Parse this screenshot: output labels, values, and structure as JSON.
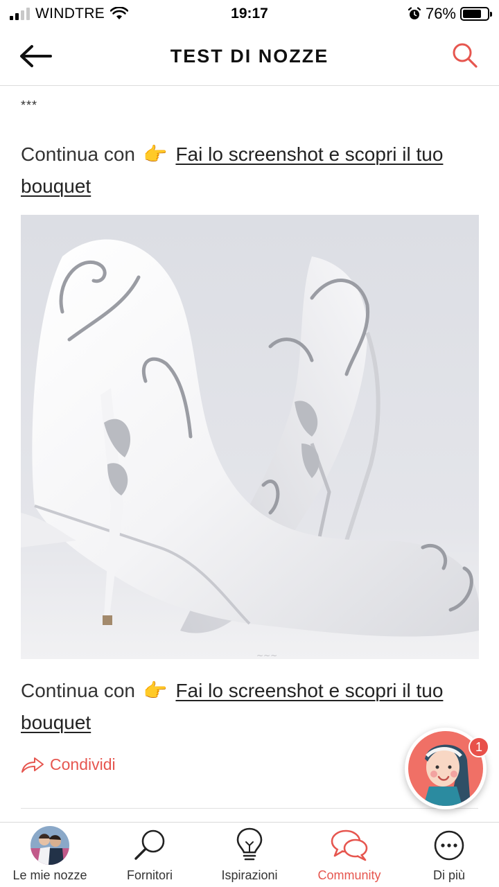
{
  "status_bar": {
    "carrier": "WINDTRE",
    "time": "19:17",
    "battery": "76%",
    "battery_level": 0.76
  },
  "header": {
    "title": "TEST DI NOZZE"
  },
  "content": {
    "separator": "***",
    "paragraph_1": {
      "prefix": "Continua con",
      "emoji": "👉",
      "link_text": "Fai lo screenshot e scopri il tuo bouquet"
    },
    "paragraph_2": {
      "prefix": "Continua con",
      "emoji": "👉",
      "link_text": "Fai lo screenshot e scopri il tuo bouquet"
    },
    "share_label": "Condividi"
  },
  "assistant": {
    "badge_count": "1"
  },
  "bottom_nav": {
    "items": [
      {
        "label": "Le mie nozze",
        "icon": "avatar"
      },
      {
        "label": "Fornitori",
        "icon": "search-icon"
      },
      {
        "label": "Ispirazioni",
        "icon": "lightbulb-icon"
      },
      {
        "label": "Community",
        "icon": "chat-bubbles-icon",
        "active": true
      },
      {
        "label": "Di più",
        "icon": "more-icon"
      }
    ]
  },
  "colors": {
    "accent": "#e6564f",
    "text": "#333333",
    "divider": "#dcdcdc"
  }
}
